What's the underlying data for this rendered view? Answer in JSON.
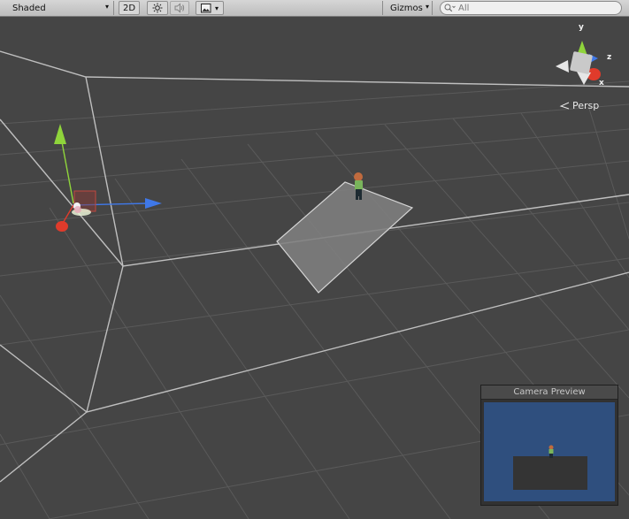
{
  "toolbar": {
    "shading_mode": "Shaded",
    "mode_2d": "2D",
    "gizmos_label": "Gizmos",
    "search_placeholder": "All",
    "icons": [
      "sun-icon",
      "speaker-icon",
      "image-icon"
    ]
  },
  "scene": {
    "projection_label": "Persp",
    "axis_labels": {
      "y": "y",
      "z": "z",
      "x": "x"
    },
    "colors": {
      "background": "#454545",
      "x_axis": "#e03b2b",
      "y_axis": "#8fd43b",
      "z_axis": "#3f78e8"
    }
  },
  "camera_preview": {
    "title": "Camera Preview",
    "background_color": "#2f4f7e"
  }
}
